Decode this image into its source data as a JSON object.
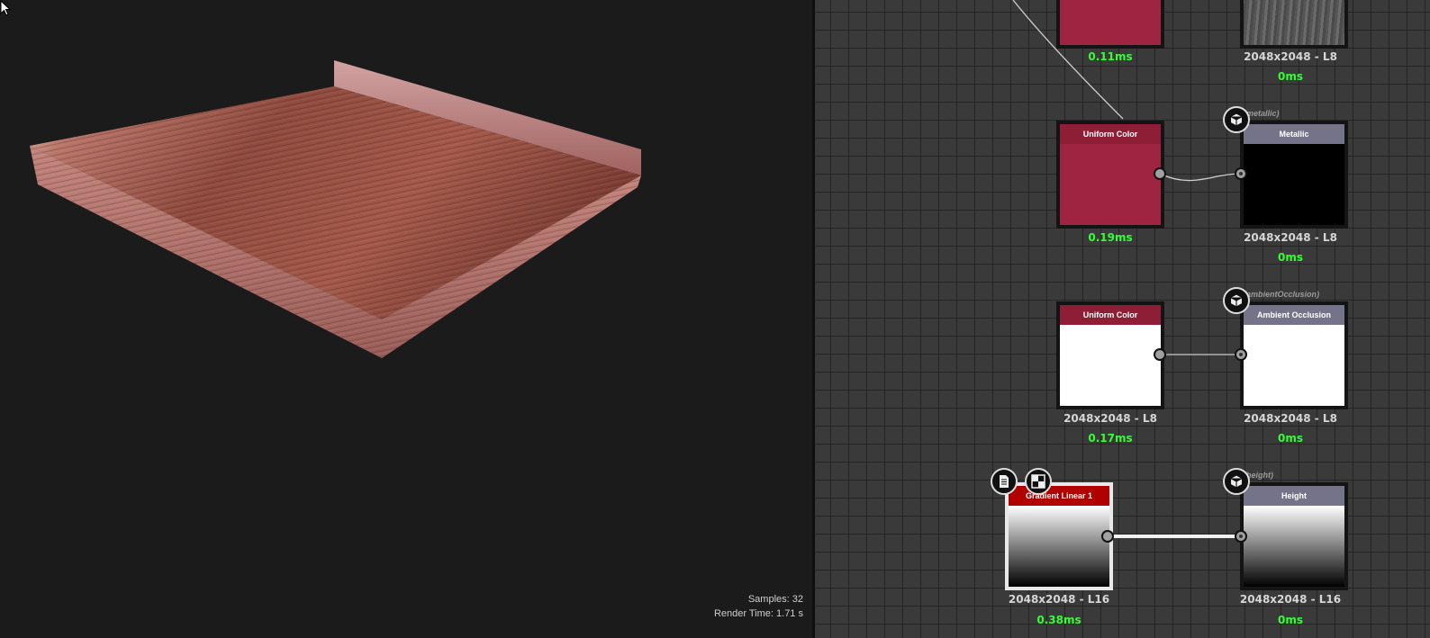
{
  "viewport": {
    "samples_label": "Samples: 32",
    "render_time_label": "Render Time: 1.71 s"
  },
  "graph": {
    "nodes": {
      "top_color": {
        "time": "0.11ms"
      },
      "top_output": {
        "resolution": "2048x2048 - L8",
        "time": "0ms"
      },
      "uniform_color_1": {
        "title": "Uniform Color",
        "time": "0.19ms"
      },
      "metallic": {
        "title": "Metallic",
        "identifier": "(metallic)",
        "resolution": "2048x2048 - L8",
        "time": "0ms"
      },
      "uniform_color_2": {
        "title": "Uniform Color",
        "resolution": "2048x2048 - L8",
        "time": "0.17ms"
      },
      "ambient_occlusion": {
        "title": "Ambient Occlusion",
        "identifier": "(ambientOcclusion)",
        "resolution": "2048x2048 - L8",
        "time": "0ms"
      },
      "gradient_linear": {
        "title": "Gradient Linear 1",
        "resolution": "2048x2048 - L16",
        "time": "0.38ms"
      },
      "height": {
        "title": "Height",
        "identifier": "(height)",
        "resolution": "2048x2048 - L16",
        "time": "0ms"
      }
    },
    "icons": {
      "output_badge": "cube-icon",
      "doc_badge": "document-icon",
      "pattern_badge": "checker-icon"
    },
    "colors": {
      "uniform_red": "#9e2441",
      "node_header_red": "#8e1e36",
      "output_header": "#74738a",
      "timing_green": "#33ff33"
    }
  }
}
